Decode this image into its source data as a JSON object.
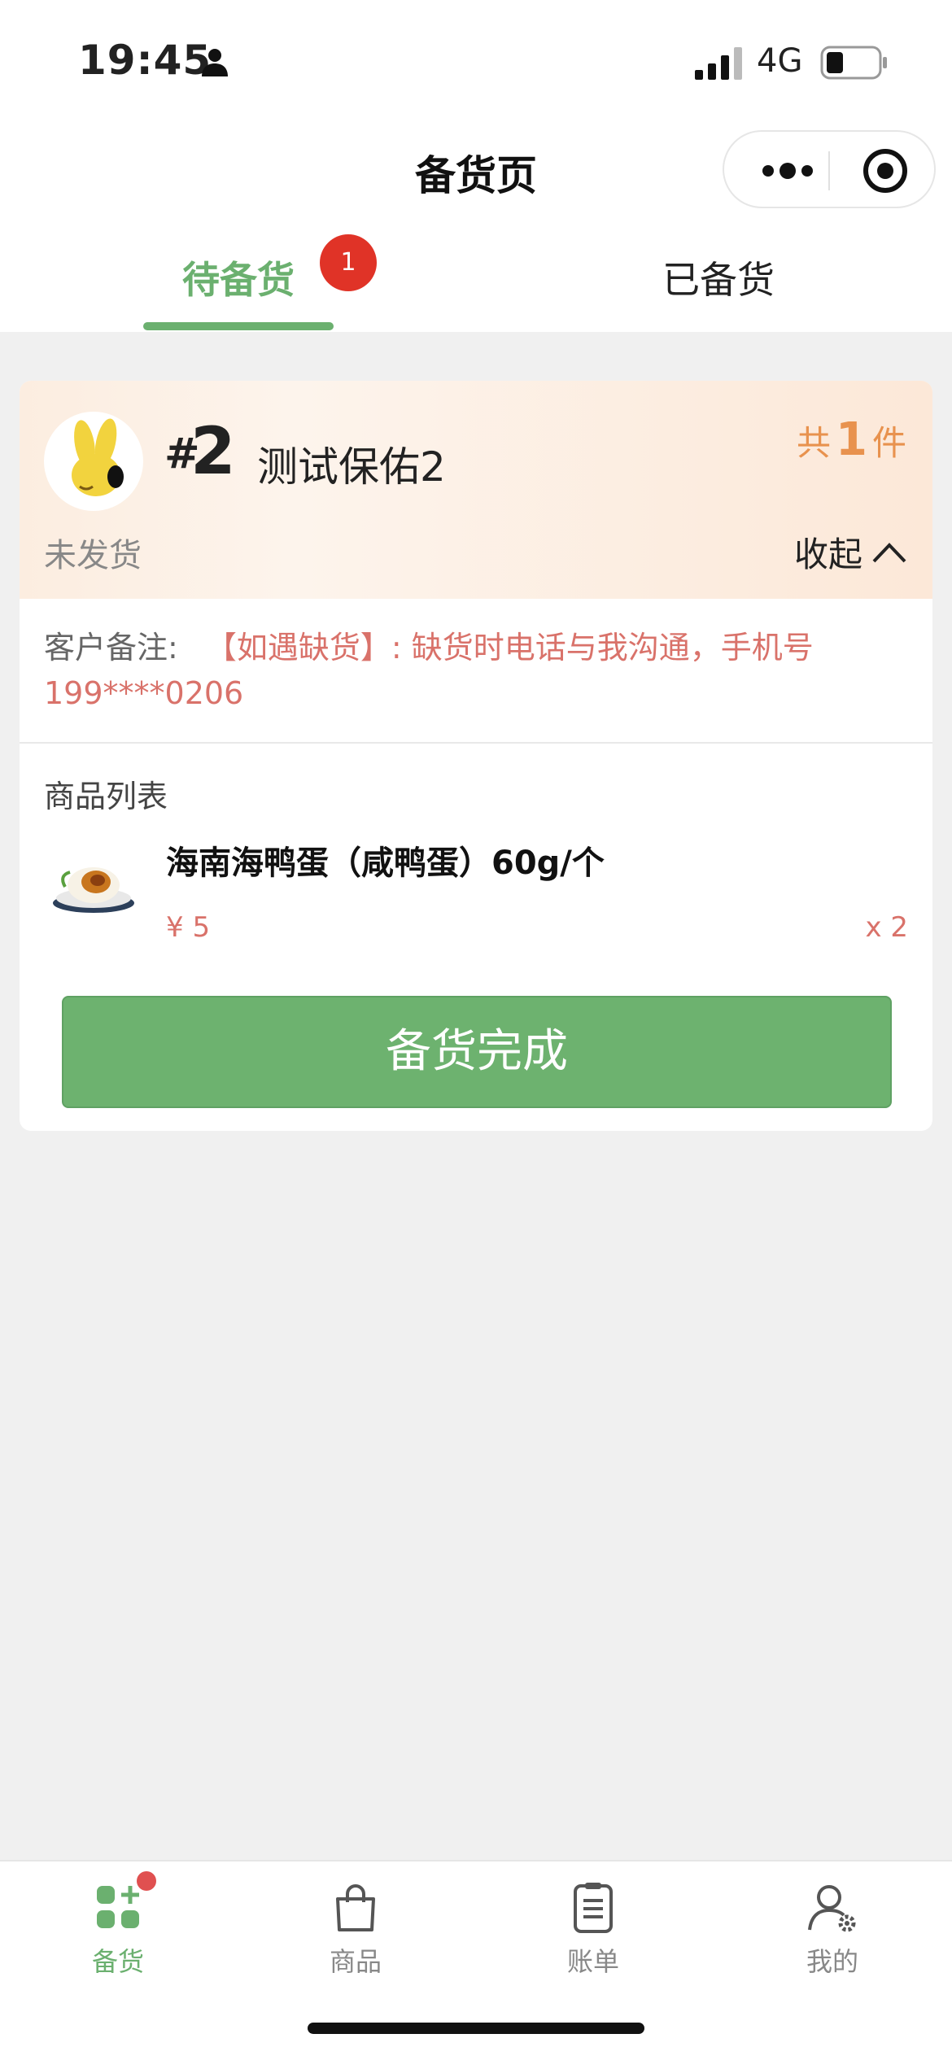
{
  "status_bar": {
    "time": "19:45",
    "network": "4G"
  },
  "nav": {
    "title": "备货页"
  },
  "tabs": [
    {
      "label": "待备货",
      "badge": "1"
    },
    {
      "label": "已备货"
    }
  ],
  "order": {
    "hash": "#",
    "number": "2",
    "customer": "测试保佑2",
    "count_prefix": "共",
    "count": "1",
    "count_suffix": "件",
    "ship_status": "未发货",
    "collapse_label": "收起",
    "remark_label": "客户备注:",
    "remark_text": "【如遇缺货】: 缺货时电话与我沟通，手机号199****0206",
    "list_title": "商品列表",
    "items": [
      {
        "name": "海南海鸭蛋（咸鸭蛋）60g/个",
        "price": "¥ 5",
        "qty": "x 2"
      }
    ],
    "done_button": "备货完成"
  },
  "tabbar": [
    {
      "label": "备货",
      "icon": "stock-icon",
      "active": true
    },
    {
      "label": "商品",
      "icon": "bag-icon"
    },
    {
      "label": "账单",
      "icon": "clipboard-icon"
    },
    {
      "label": "我的",
      "icon": "user-settings-icon"
    }
  ],
  "colors": {
    "accent": "#6bb06f",
    "badge": "#e03327",
    "remark": "#d9726a",
    "count": "#e8924e"
  }
}
